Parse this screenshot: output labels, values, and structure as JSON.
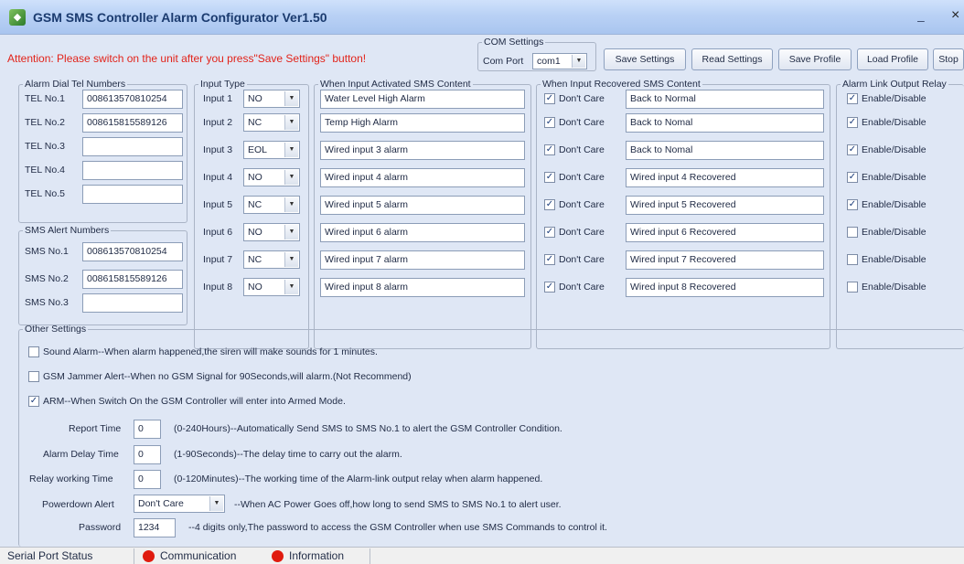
{
  "window": {
    "title": "GSM SMS Controller Alarm Configurator Ver1.50",
    "icon": "app-icon",
    "minimize": "–",
    "close": "×"
  },
  "attention": "Attention: Please switch on the unit after you press\"Save Settings\" button!",
  "com": {
    "legend": "COM Settings",
    "port_label": "Com Port",
    "port_value": "com1"
  },
  "toolbar": {
    "save_settings": "Save Settings",
    "read_settings": "Read Settings",
    "save_profile": "Save Profile",
    "load_profile": "Load Profile",
    "stop": "Stop"
  },
  "dial": {
    "legend": "Alarm Dial Tel Numbers",
    "rows": [
      {
        "label": "TEL No.1",
        "value": "008613570810254"
      },
      {
        "label": "TEL No.2",
        "value": "008615815589126"
      },
      {
        "label": "TEL No.3",
        "value": ""
      },
      {
        "label": "TEL No.4",
        "value": ""
      },
      {
        "label": "TEL No.5",
        "value": ""
      }
    ]
  },
  "sms_alert": {
    "legend": "SMS Alert Numbers",
    "rows": [
      {
        "label": "SMS No.1",
        "value": "008613570810254"
      },
      {
        "label": "SMS No.2",
        "value": "008615815589126"
      },
      {
        "label": "SMS No.3",
        "value": ""
      }
    ]
  },
  "input_type": {
    "legend": "Input Type",
    "rows": [
      {
        "label": "Input 1",
        "value": "NO"
      },
      {
        "label": "Input 2",
        "value": "NC"
      },
      {
        "label": "Input 3",
        "value": "EOL"
      },
      {
        "label": "Input 4",
        "value": "NO"
      },
      {
        "label": "Input 5",
        "value": "NC"
      },
      {
        "label": "Input 6",
        "value": "NO"
      },
      {
        "label": "Input 7",
        "value": "NC"
      },
      {
        "label": "Input 8",
        "value": "NO"
      }
    ]
  },
  "activated": {
    "legend": "When Input Activated SMS Content",
    "rows": [
      "Water Level High Alarm",
      "Temp High Alarm",
      "Wired input 3 alarm",
      "Wired input 4 alarm",
      "Wired input 5 alarm",
      "Wired input 6 alarm",
      "Wired input 7 alarm",
      "Wired input 8 alarm"
    ]
  },
  "recovered": {
    "legend": "When Input Recovered SMS Content",
    "dont_care_label": "Don't Care",
    "rows": [
      {
        "checked": true,
        "text": "Back to Normal"
      },
      {
        "checked": true,
        "text": "Back to Nomal"
      },
      {
        "checked": true,
        "text": "Back to Nomal"
      },
      {
        "checked": true,
        "text": "Wired input 4 Recovered"
      },
      {
        "checked": true,
        "text": "Wired input 5 Recovered"
      },
      {
        "checked": true,
        "text": "Wired input 6 Recovered"
      },
      {
        "checked": true,
        "text": "Wired input 7 Recovered"
      },
      {
        "checked": true,
        "text": "Wired input 8 Recovered"
      }
    ]
  },
  "relay": {
    "legend": "Alarm Link Output Relay",
    "label": "Enable/Disable",
    "checked": [
      true,
      true,
      true,
      true,
      true,
      false,
      false,
      false
    ]
  },
  "other": {
    "legend": "Other Settings",
    "sound_alarm": {
      "checked": false,
      "label": "Sound Alarm--When alarm happened,the siren will make sounds for 1 minutes."
    },
    "jammer": {
      "checked": false,
      "label": "GSM Jammer Alert--When no GSM Signal for 90Seconds,will alarm.(Not Recommend)"
    },
    "arm": {
      "checked": true,
      "label": "ARM--When Switch On the GSM Controller will enter into Armed Mode."
    },
    "report_time": {
      "label": "Report Time",
      "value": "0",
      "desc": "(0-240Hours)--Automatically Send SMS to SMS No.1 to alert the GSM Controller Condition."
    },
    "alarm_delay": {
      "label": "Alarm Delay Time",
      "value": "0",
      "desc": "(1-90Seconds)--The delay time to carry out the alarm."
    },
    "relay_time": {
      "label": "Relay working Time",
      "value": "0",
      "desc": "(0-120Minutes)--The working time of the Alarm-link output relay when alarm happened."
    },
    "powerdown": {
      "label": "Powerdown Alert",
      "value": "Don't Care",
      "desc": "--When AC Power Goes off,how long to send SMS to SMS No.1 to alert user."
    },
    "password": {
      "label": "Password",
      "value": "1234",
      "desc": "--4 digits only,The password to access the GSM Controller when use SMS Commands to control it."
    }
  },
  "status": {
    "serial_port": "Serial Port Status",
    "communication": "Communication",
    "information": "Information",
    "led_color": "#e01b0f"
  }
}
